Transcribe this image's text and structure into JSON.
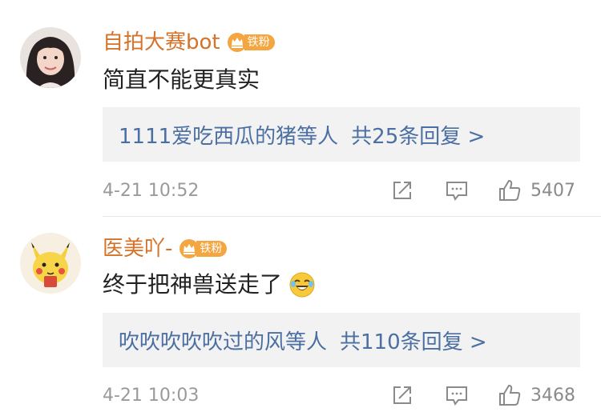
{
  "comments": [
    {
      "username": "自拍大赛bot",
      "badge": "铁粉",
      "text": "简直不能更真实",
      "reply_summary": "1111爱吃西瓜的猪等人",
      "reply_count": "共25条回复 >",
      "time": "4-21 10:52",
      "likes": "5407"
    },
    {
      "username": "医美吖-",
      "badge": "铁粉",
      "text": "终于把神兽送走了",
      "reply_summary": "吹吹吹吹吹过的风等人",
      "reply_count": "共110条回复 >",
      "time": "4-21 10:03",
      "likes": "3468"
    }
  ],
  "colors": {
    "username": "#d4732a",
    "link": "#4b6fa3",
    "badge": "#f4a640",
    "muted": "#9a9a9a",
    "reply_bg": "#f2f2f2"
  },
  "icons": [
    "share-icon",
    "comment-icon",
    "like-icon",
    "laugh-emoji-icon",
    "fan-crown-icon"
  ]
}
